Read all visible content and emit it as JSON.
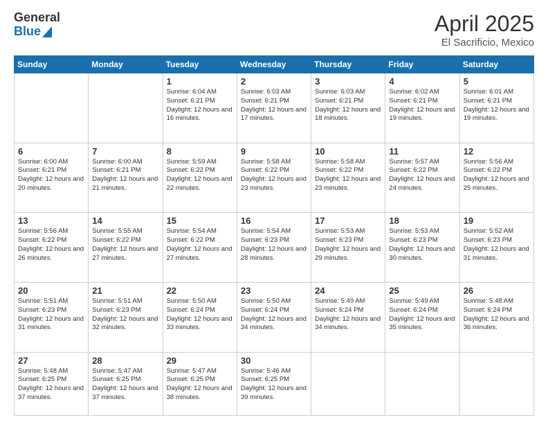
{
  "logo": {
    "general": "General",
    "blue": "Blue"
  },
  "header": {
    "month": "April 2025",
    "location": "El Sacrificio, Mexico"
  },
  "weekdays": [
    "Sunday",
    "Monday",
    "Tuesday",
    "Wednesday",
    "Thursday",
    "Friday",
    "Saturday"
  ],
  "weeks": [
    [
      {
        "day": "",
        "info": ""
      },
      {
        "day": "",
        "info": ""
      },
      {
        "day": "1",
        "info": "Sunrise: 6:04 AM\nSunset: 6:21 PM\nDaylight: 12 hours and 16 minutes."
      },
      {
        "day": "2",
        "info": "Sunrise: 6:03 AM\nSunset: 6:21 PM\nDaylight: 12 hours and 17 minutes."
      },
      {
        "day": "3",
        "info": "Sunrise: 6:03 AM\nSunset: 6:21 PM\nDaylight: 12 hours and 18 minutes."
      },
      {
        "day": "4",
        "info": "Sunrise: 6:02 AM\nSunset: 6:21 PM\nDaylight: 12 hours and 19 minutes."
      },
      {
        "day": "5",
        "info": "Sunrise: 6:01 AM\nSunset: 6:21 PM\nDaylight: 12 hours and 19 minutes."
      }
    ],
    [
      {
        "day": "6",
        "info": "Sunrise: 6:00 AM\nSunset: 6:21 PM\nDaylight: 12 hours and 20 minutes."
      },
      {
        "day": "7",
        "info": "Sunrise: 6:00 AM\nSunset: 6:21 PM\nDaylight: 12 hours and 21 minutes."
      },
      {
        "day": "8",
        "info": "Sunrise: 5:59 AM\nSunset: 6:22 PM\nDaylight: 12 hours and 22 minutes."
      },
      {
        "day": "9",
        "info": "Sunrise: 5:58 AM\nSunset: 6:22 PM\nDaylight: 12 hours and 23 minutes."
      },
      {
        "day": "10",
        "info": "Sunrise: 5:58 AM\nSunset: 6:22 PM\nDaylight: 12 hours and 23 minutes."
      },
      {
        "day": "11",
        "info": "Sunrise: 5:57 AM\nSunset: 6:22 PM\nDaylight: 12 hours and 24 minutes."
      },
      {
        "day": "12",
        "info": "Sunrise: 5:56 AM\nSunset: 6:22 PM\nDaylight: 12 hours and 25 minutes."
      }
    ],
    [
      {
        "day": "13",
        "info": "Sunrise: 5:56 AM\nSunset: 6:22 PM\nDaylight: 12 hours and 26 minutes."
      },
      {
        "day": "14",
        "info": "Sunrise: 5:55 AM\nSunset: 6:22 PM\nDaylight: 12 hours and 27 minutes."
      },
      {
        "day": "15",
        "info": "Sunrise: 5:54 AM\nSunset: 6:22 PM\nDaylight: 12 hours and 27 minutes."
      },
      {
        "day": "16",
        "info": "Sunrise: 5:54 AM\nSunset: 6:23 PM\nDaylight: 12 hours and 28 minutes."
      },
      {
        "day": "17",
        "info": "Sunrise: 5:53 AM\nSunset: 6:23 PM\nDaylight: 12 hours and 29 minutes."
      },
      {
        "day": "18",
        "info": "Sunrise: 5:53 AM\nSunset: 6:23 PM\nDaylight: 12 hours and 30 minutes."
      },
      {
        "day": "19",
        "info": "Sunrise: 5:52 AM\nSunset: 6:23 PM\nDaylight: 12 hours and 31 minutes."
      }
    ],
    [
      {
        "day": "20",
        "info": "Sunrise: 5:51 AM\nSunset: 6:23 PM\nDaylight: 12 hours and 31 minutes."
      },
      {
        "day": "21",
        "info": "Sunrise: 5:51 AM\nSunset: 6:23 PM\nDaylight: 12 hours and 32 minutes."
      },
      {
        "day": "22",
        "info": "Sunrise: 5:50 AM\nSunset: 6:24 PM\nDaylight: 12 hours and 33 minutes."
      },
      {
        "day": "23",
        "info": "Sunrise: 5:50 AM\nSunset: 6:24 PM\nDaylight: 12 hours and 34 minutes."
      },
      {
        "day": "24",
        "info": "Sunrise: 5:49 AM\nSunset: 6:24 PM\nDaylight: 12 hours and 34 minutes."
      },
      {
        "day": "25",
        "info": "Sunrise: 5:49 AM\nSunset: 6:24 PM\nDaylight: 12 hours and 35 minutes."
      },
      {
        "day": "26",
        "info": "Sunrise: 5:48 AM\nSunset: 6:24 PM\nDaylight: 12 hours and 36 minutes."
      }
    ],
    [
      {
        "day": "27",
        "info": "Sunrise: 5:48 AM\nSunset: 6:25 PM\nDaylight: 12 hours and 37 minutes."
      },
      {
        "day": "28",
        "info": "Sunrise: 5:47 AM\nSunset: 6:25 PM\nDaylight: 12 hours and 37 minutes."
      },
      {
        "day": "29",
        "info": "Sunrise: 5:47 AM\nSunset: 6:25 PM\nDaylight: 12 hours and 38 minutes."
      },
      {
        "day": "30",
        "info": "Sunrise: 5:46 AM\nSunset: 6:25 PM\nDaylight: 12 hours and 39 minutes."
      },
      {
        "day": "",
        "info": ""
      },
      {
        "day": "",
        "info": ""
      },
      {
        "day": "",
        "info": ""
      }
    ]
  ]
}
